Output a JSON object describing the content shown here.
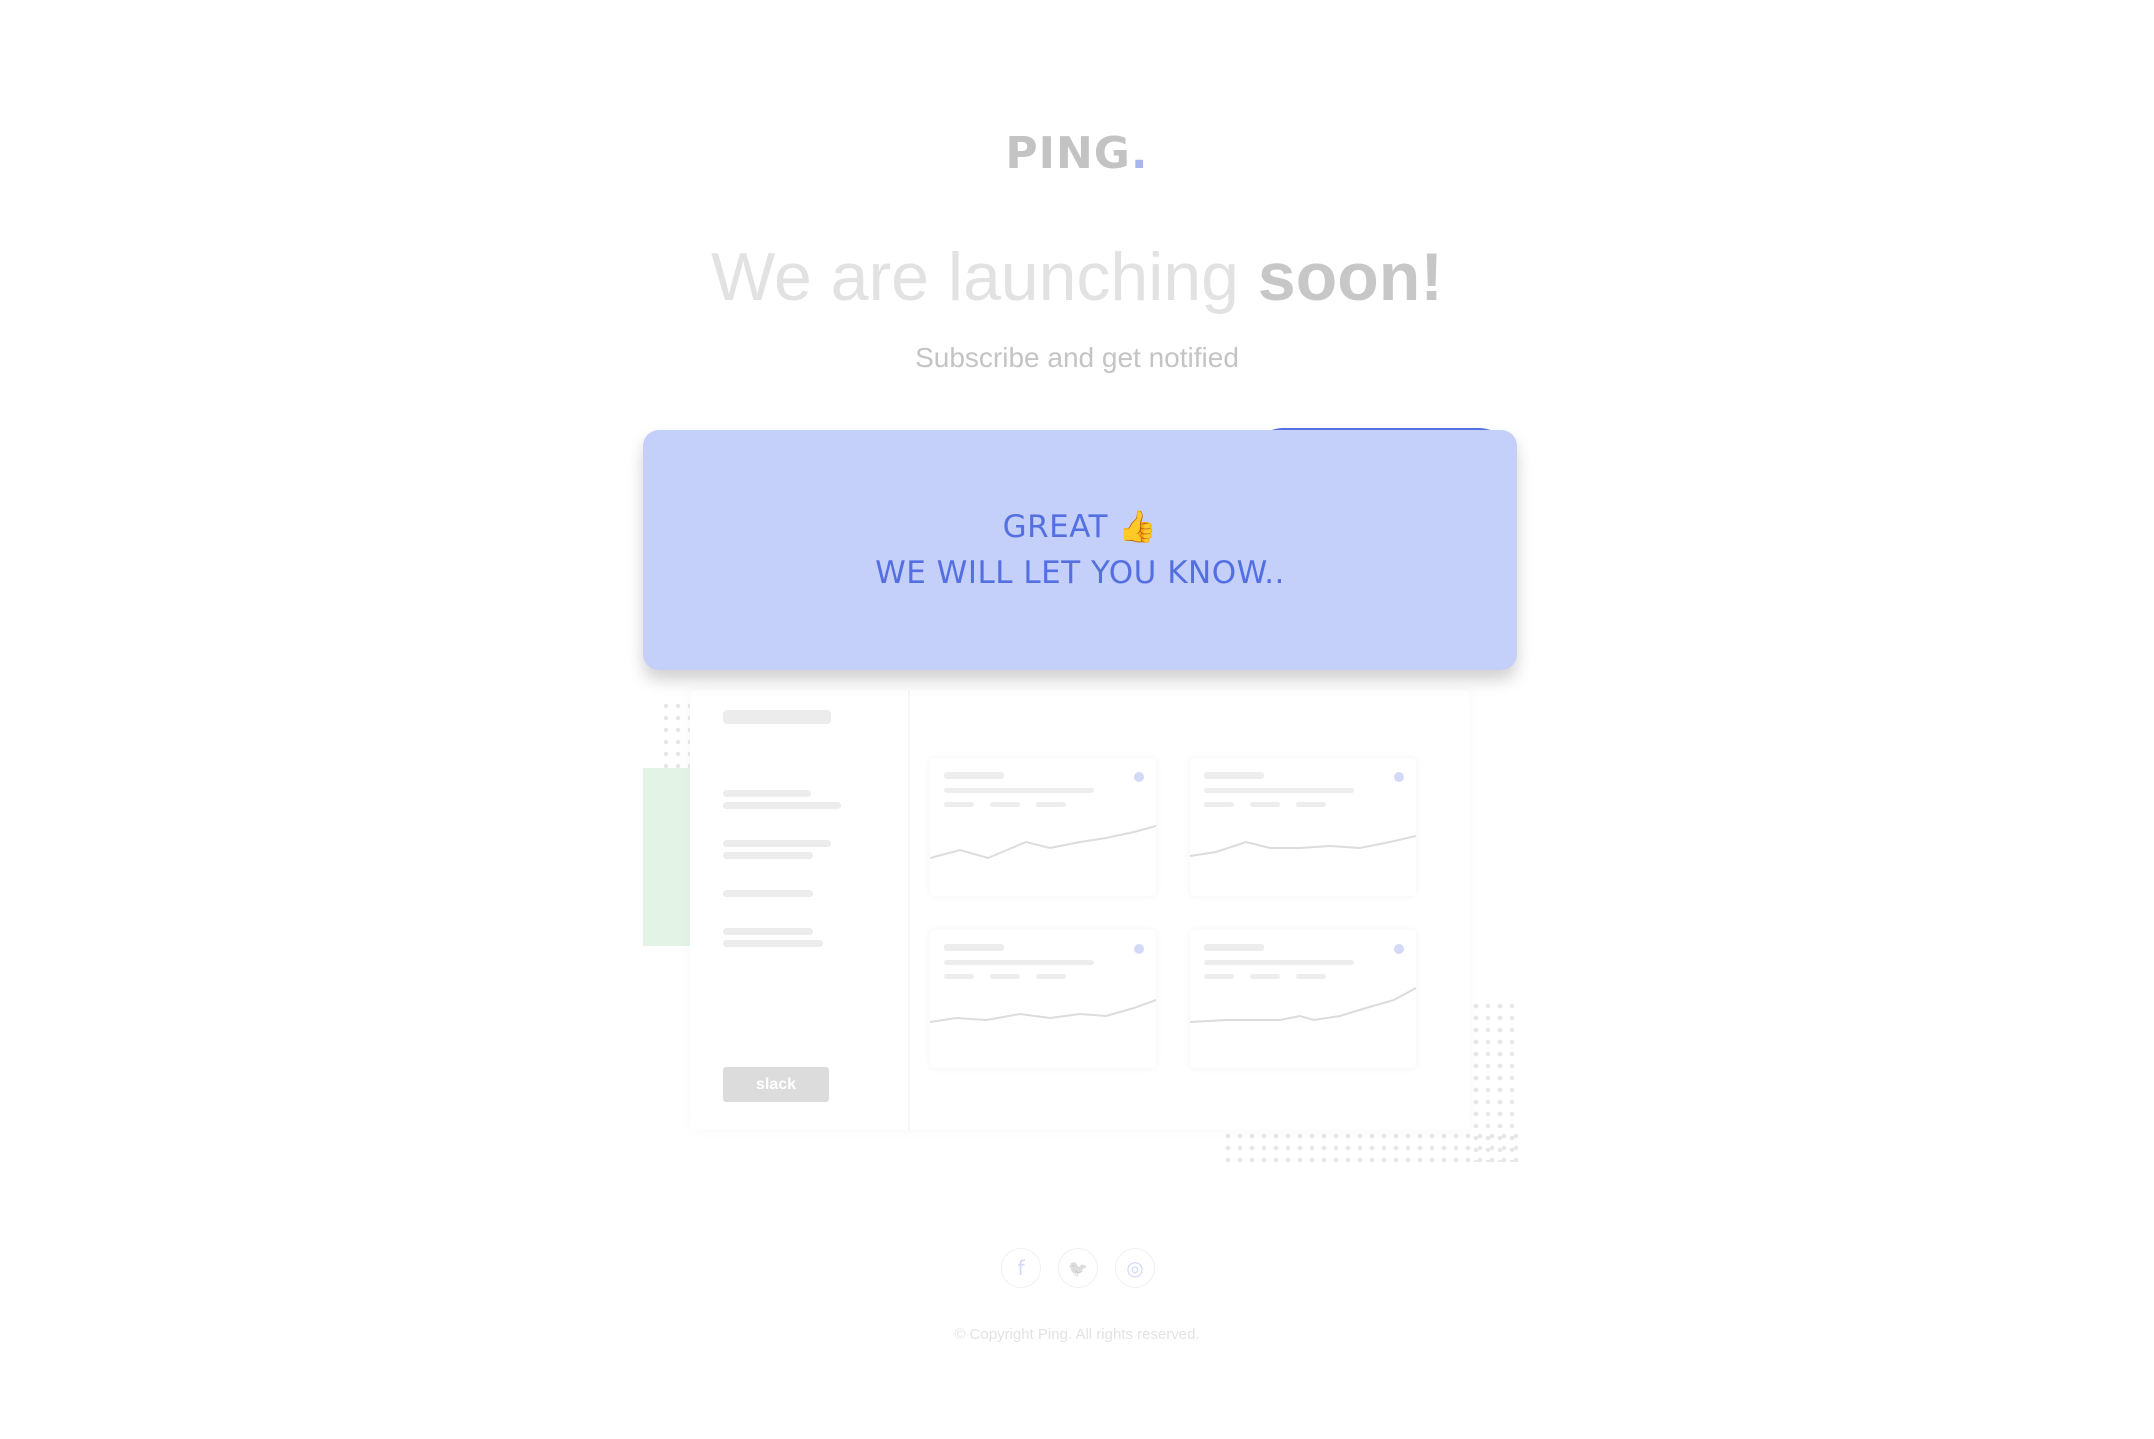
{
  "brand": {
    "logo_text": "PING",
    "logo_dot": "."
  },
  "hero": {
    "headline_light": "We are launching",
    "headline_bold": "soon!",
    "subtitle": "Subscribe and get notified"
  },
  "toast": {
    "line1": "GREAT 👍",
    "line2": "WE WILL LET YOU KNOW.."
  },
  "illustration": {
    "slack_label": "slack",
    "colors": {
      "accent": "#4d6ce4",
      "toast_bg": "#c4cffa",
      "toast_text": "#5470e0",
      "green": "#e3f3e5"
    }
  },
  "social": {
    "facebook_glyph": "f",
    "twitter_glyph": "🐦",
    "instagram_glyph": "◎",
    "icons": [
      "facebook-icon",
      "twitter-icon",
      "instagram-icon"
    ]
  },
  "footer": {
    "copyright": "© Copyright Ping. All rights reserved."
  }
}
